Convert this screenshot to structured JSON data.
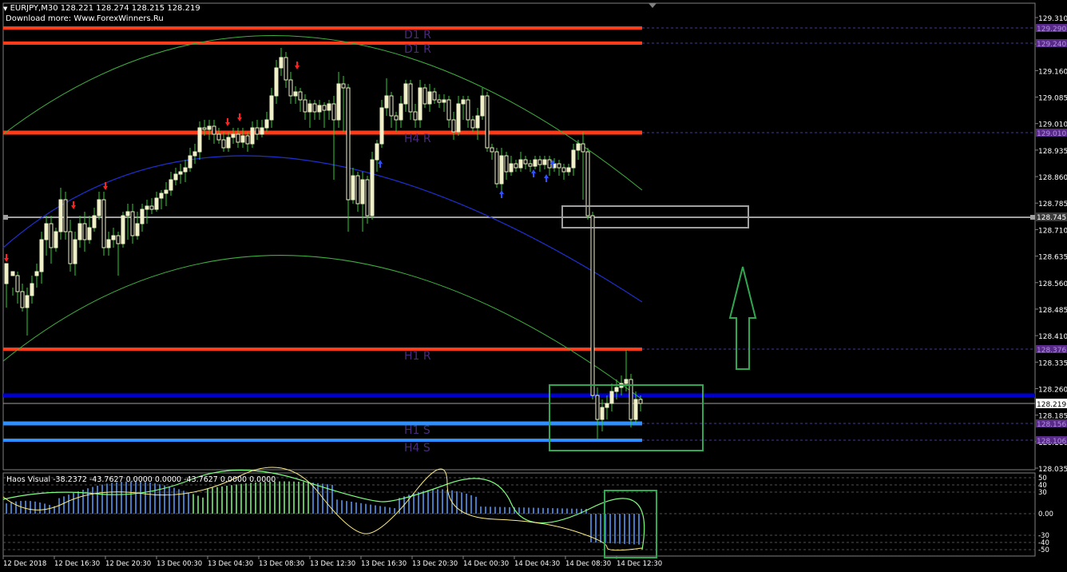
{
  "header": {
    "symbol_line": "EURJPY,M30  128.221 128.274 128.215 128.219",
    "download_note": "Download more: Www.ForexWinners.Ru"
  },
  "indicator": {
    "name_line": "Haos Visual -38.2372 -43.7627 0.0000 0.0000 -43.7627 0.0000 0.0000",
    "axis_labels": [
      "50",
      "40",
      "30",
      "0.00",
      "-30",
      "-40",
      "-50"
    ]
  },
  "price_axis": {
    "labels": [
      "129.310",
      "129.235",
      "129.160",
      "129.085",
      "129.010",
      "128.935",
      "128.860",
      "128.785",
      "128.710",
      "128.635",
      "128.560",
      "128.485",
      "128.410",
      "128.335",
      "128.260",
      "128.185",
      "128.110",
      "128.035"
    ],
    "current_price": "128.219",
    "highlighted_price": "128.745"
  },
  "level_tags": {
    "d1r_a": "129.290",
    "d1r_b": "129.240",
    "h4r": "129.010",
    "h1r": "128.376",
    "h1s": "128.156",
    "h4s": "128.106"
  },
  "level_labels": {
    "d1r_a": "D1 R",
    "d1r_b": "D1 R",
    "h4r": "H4 R",
    "h1r": "H1 R",
    "h1s": "H1 S",
    "h4s": "H4 S"
  },
  "time_axis": {
    "labels": [
      "12 Dec 2018",
      "12 Dec 16:30",
      "12 Dec 20:30",
      "13 Dec 00:30",
      "13 Dec 04:30",
      "13 Dec 08:30",
      "13 Dec 12:30",
      "13 Dec 16:30",
      "13 Dec 20:30",
      "14 Dec 00:30",
      "14 Dec 04:30",
      "14 Dec 08:30",
      "14 Dec 12:30"
    ]
  },
  "colors": {
    "background": "#000000",
    "bull_candle": "#f0f0c8",
    "wick": "#32cd32",
    "resistance": "#ff3b1a",
    "support_dark": "#0000cc",
    "support_light": "#2f8fff",
    "ma_blue": "#1f2fd0",
    "channel_green": "#3fae3f",
    "box_green": "#2fa84f",
    "box_gray": "#a0a0a0",
    "tag_purple": "#5a2a8a",
    "label_purple": "#4a2a7a",
    "hist_blue": "#5aa0ff",
    "hist_green": "#7fff7f",
    "signal_line": "#ffee88"
  }
}
